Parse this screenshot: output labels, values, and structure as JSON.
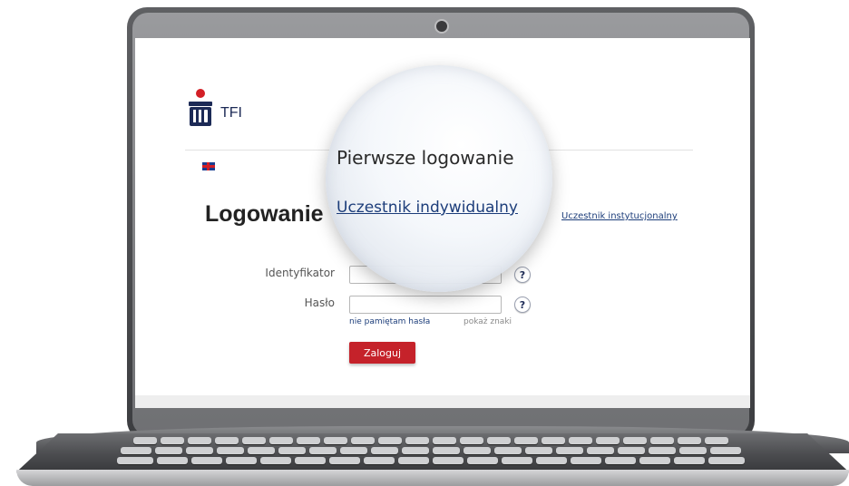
{
  "brand": {
    "name": "TFI"
  },
  "language": {
    "flag_icon": "uk-flag-icon"
  },
  "login": {
    "title": "Logowanie",
    "tabs": {
      "individual": "Uczestnik indywidualny",
      "institutional": "Uczestnik instytucjonalny"
    },
    "id_label": "Identyfikator",
    "id_value": "",
    "password_label": "Hasło",
    "password_value": "",
    "help_icon_text": "?",
    "forgot_password": "nie pamiętam hasła",
    "show_chars": "pokaż znaki",
    "submit": "Zaloguj"
  },
  "magnifier": {
    "title": "Pierwsze logowanie"
  },
  "colors": {
    "brand_navy": "#1c2a56",
    "accent_red": "#c5222a",
    "link_blue": "#1c3d7a"
  }
}
